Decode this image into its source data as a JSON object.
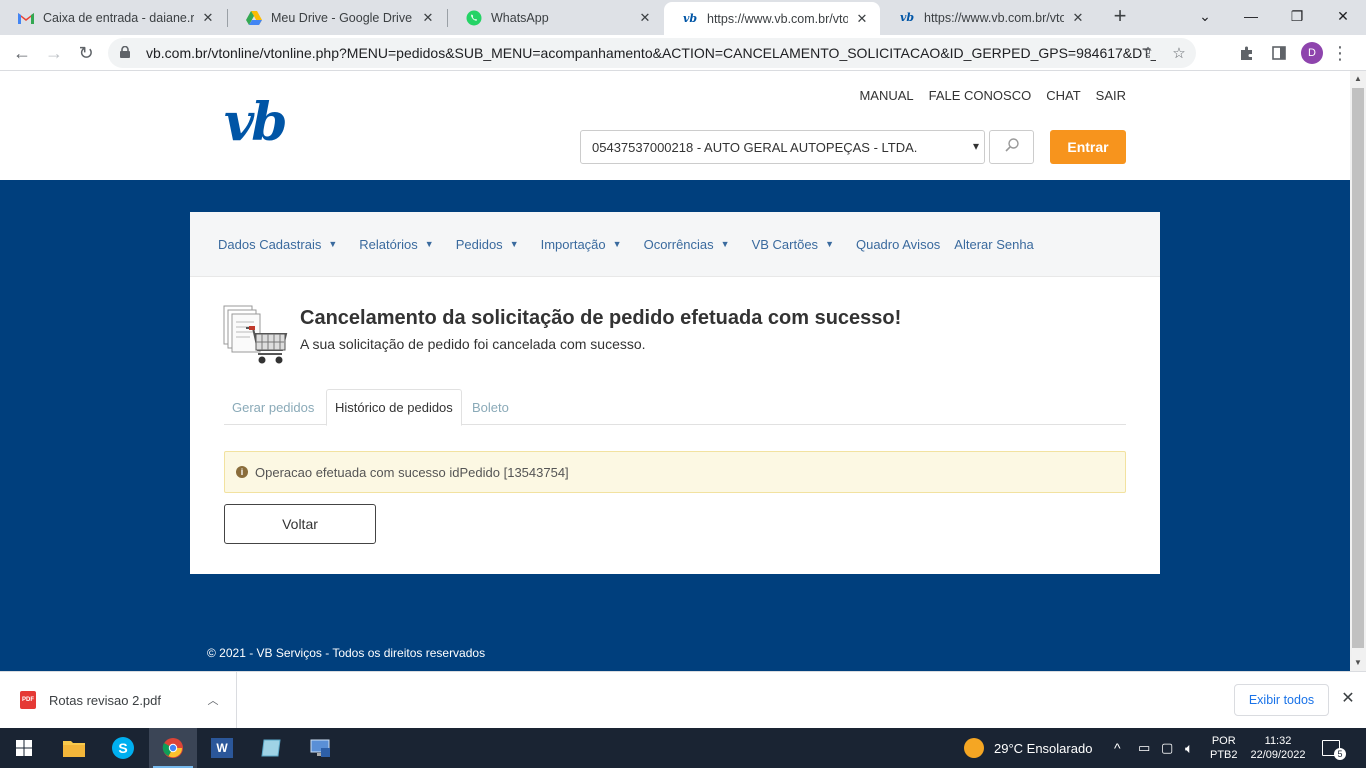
{
  "browser": {
    "tabs": [
      {
        "title": "Caixa de entrada - daiane.ro",
        "icon": "gmail-icon",
        "active": false
      },
      {
        "title": "Meu Drive - Google Drive",
        "icon": "google-drive-icon",
        "active": false
      },
      {
        "title": "WhatsApp",
        "icon": "whatsapp-icon",
        "active": false
      },
      {
        "title": "https://www.vb.com.br/vtonl",
        "icon": "vb-favicon",
        "active": true
      },
      {
        "title": "https://www.vb.com.br/vtonl",
        "icon": "vb-favicon",
        "active": false
      }
    ],
    "url": "vb.com.br/vtonline/vtonline.php?MENU=pedidos&SUB_MENU=acompanhamento&ACTION=CANCELAMENTO_SOLICITACAO&ID_GERPED_GPS=984617&DT_SOLI...",
    "profile_initial": "D"
  },
  "site": {
    "logo": "vb",
    "top_links": [
      "MANUAL",
      "FALE CONOSCO",
      "CHAT",
      "SAIR"
    ],
    "company_selected": "05437537000218 - AUTO GERAL AUTOPEÇAS - LTDA.",
    "enter_label": "Entrar",
    "menu": [
      {
        "label": "Dados Cadastrais",
        "has_caret": true
      },
      {
        "label": "Relatórios",
        "has_caret": true
      },
      {
        "label": "Pedidos",
        "has_caret": true
      },
      {
        "label": "Importação",
        "has_caret": true
      },
      {
        "label": "Ocorrências",
        "has_caret": true
      },
      {
        "label": "VB Cartões",
        "has_caret": true
      },
      {
        "label": "Quadro Avisos",
        "has_caret": false
      },
      {
        "label": "Alterar Senha",
        "has_caret": false
      }
    ],
    "page_title": "Cancelamento da solicitação de pedido efetuada com sucesso!",
    "page_subtitle": "A sua solicitação de pedido foi cancelada com sucesso.",
    "tabs": [
      {
        "label": "Gerar pedidos",
        "active": false
      },
      {
        "label": "Histórico de pedidos",
        "active": true
      },
      {
        "label": "Boleto",
        "active": false
      }
    ],
    "alert_message": "Operacao efetuada com sucesso idPedido [13543754]",
    "back_label": "Voltar",
    "footer": "© 2021 - VB Serviços - Todos os direitos reservados",
    "colors": {
      "brand_blue": "#003f7d",
      "accent_orange": "#f7941d",
      "logo_blue": "#0055a6"
    }
  },
  "downloads": {
    "file_name": "Rotas revisao 2.pdf",
    "show_all_label": "Exibir todos"
  },
  "taskbar": {
    "weather": "29°C  Ensolarado",
    "language": "POR",
    "layout": "PTB2",
    "time": "11:32",
    "date": "22/09/2022",
    "notifications": "5"
  }
}
